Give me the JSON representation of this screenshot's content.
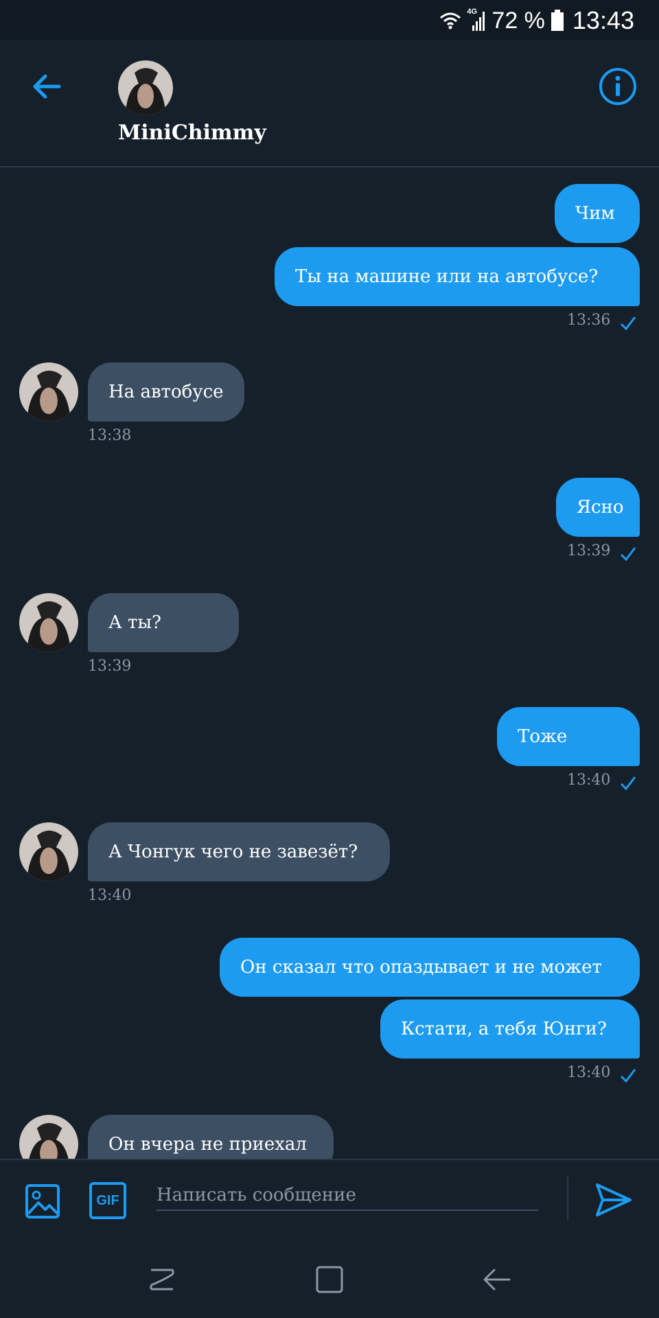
{
  "status_bar": {
    "network": "4G",
    "battery_percent": "72 %",
    "time": "13:43"
  },
  "header": {
    "contact_name": "MiniChimmy"
  },
  "messages": [
    {
      "direction": "out",
      "text": "Чим"
    },
    {
      "direction": "out",
      "text": "Ты на машине или на автобусе?",
      "time": "13:36"
    },
    {
      "direction": "in",
      "text": "На автобусе",
      "time": "13:38"
    },
    {
      "direction": "out",
      "text": "Ясно",
      "time": "13:39"
    },
    {
      "direction": "in",
      "text": "А ты?",
      "time": "13:39"
    },
    {
      "direction": "out",
      "text": "Тоже",
      "time": "13:40"
    },
    {
      "direction": "in",
      "text": "А Чонгук чего не завезёт?",
      "time": "13:40"
    },
    {
      "direction": "out",
      "text": "Он сказал что опаздывает и не может"
    },
    {
      "direction": "out",
      "text": "Кстати, а тебя Юнги?",
      "time": "13:40"
    },
    {
      "direction": "in",
      "text": "Он вчера не приехал"
    }
  ],
  "composer": {
    "gif_label": "GIF",
    "placeholder": "Написать сообщение"
  },
  "colors": {
    "background": "#15202b",
    "accent": "#1d9bf0",
    "incoming_bubble": "#3d4f63",
    "muted_text": "#8899a6"
  },
  "icons": {
    "back": "arrow-left-icon",
    "info": "info-icon",
    "image": "image-icon",
    "send": "send-icon",
    "nav_recents": "recents-icon",
    "nav_home": "home-icon",
    "nav_back": "nav-back-icon"
  }
}
